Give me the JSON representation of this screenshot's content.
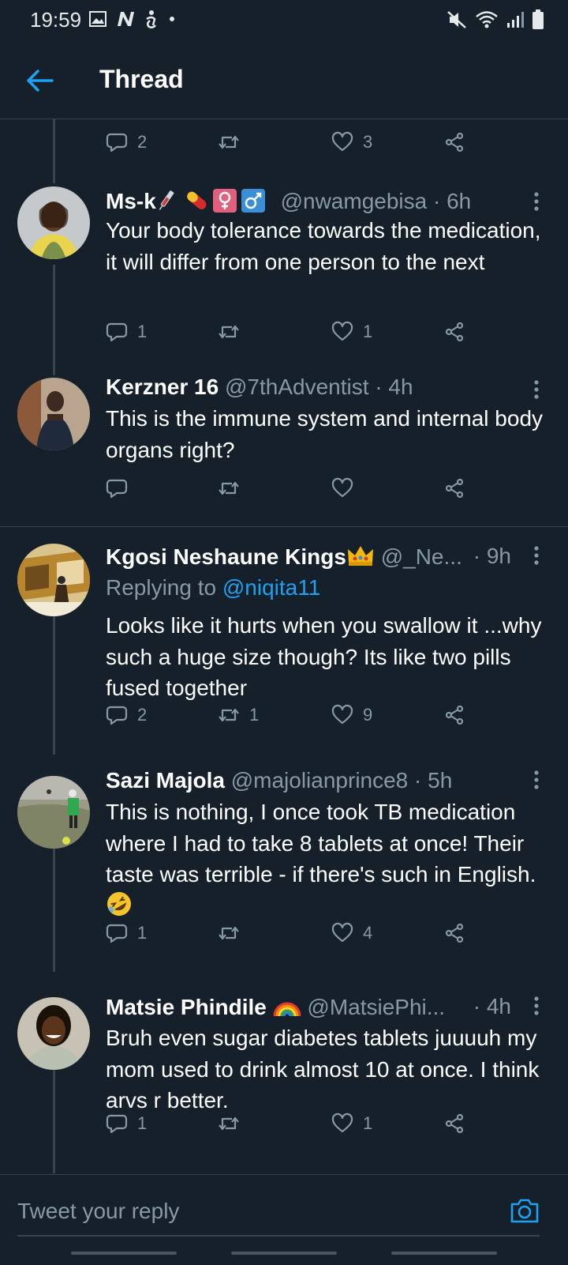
{
  "status": {
    "time": "19:59"
  },
  "header": {
    "title": "Thread"
  },
  "top_actions": {
    "replies": "2",
    "retweets": "",
    "likes": "3"
  },
  "tweets": [
    {
      "name": "Ms-k",
      "handle": "@nwamgebisa · 6h",
      "text": "Your body tolerance towards the medication, it will differ from one person to the next",
      "replies": "1",
      "retweets": "",
      "likes": "1"
    },
    {
      "name": "Kerzner 16",
      "handle": "@7thAdventist · 4h",
      "text": "This is the immune system and internal body organs right?",
      "replies": "",
      "retweets": "",
      "likes": ""
    },
    {
      "name": "Kgosi Neshaune Kings",
      "handle": "@_Ne...",
      "time": "· 9h",
      "replying_prefix": "Replying to ",
      "replying_to": "@niqita11",
      "text": "Looks like it hurts when you swallow it ...why such a huge size though? Its like two pills fused together",
      "replies": "2",
      "retweets": "1",
      "likes": "9"
    },
    {
      "name": "Sazi Majola",
      "handle": "@majolianprince8 · 5h",
      "text": "This is nothing, I once took TB medication where I had to take 8 tablets at once! Their taste was terrible - if there's such in English.",
      "replies": "1",
      "retweets": "",
      "likes": "4"
    },
    {
      "name": "Matsie Phindile",
      "handle": "@MatsiePhi...",
      "time": "· 4h",
      "text": "Bruh even sugar diabetes tablets juuuuh my mom used to drink almost 10  at once. I think arvs r better.",
      "replies": "1",
      "retweets": "",
      "likes": "1"
    }
  ],
  "composer": {
    "placeholder": "Tweet your reply"
  },
  "colors": {
    "background": "#15202b",
    "accent": "#1da1f2",
    "muted": "#8899a6",
    "divider": "#38444d"
  }
}
